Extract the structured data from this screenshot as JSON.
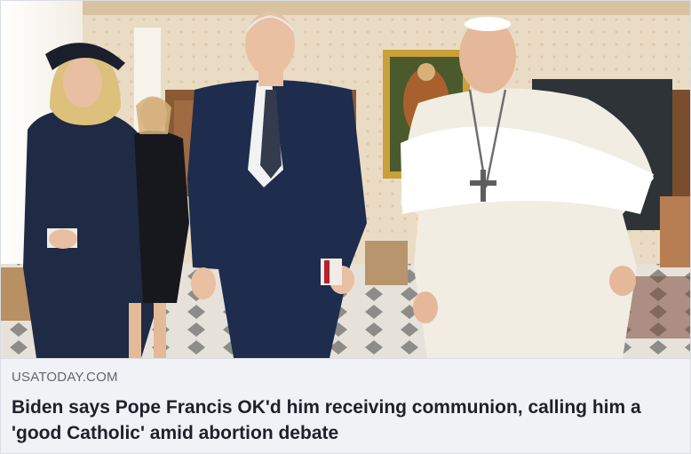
{
  "link_preview": {
    "domain": "USATODAY.COM",
    "headline": "Biden says Pope Francis OK'd him receiving communion, calling him a 'good Catholic' amid abortion debate"
  },
  "colors": {
    "card_background": "#f0f2f5",
    "domain_text": "#606770",
    "headline_text": "#1d2129"
  }
}
